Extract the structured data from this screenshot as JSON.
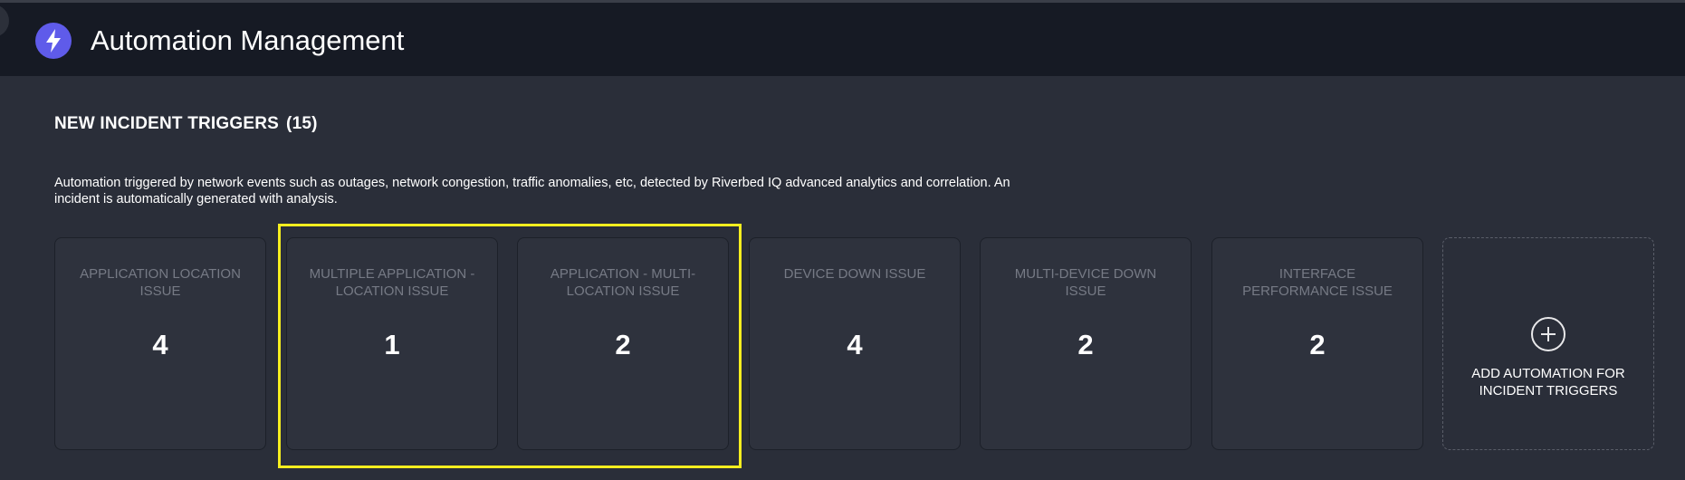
{
  "header": {
    "title": "Automation Management",
    "logo_icon": "lightning-bolt-icon"
  },
  "section": {
    "title": "NEW INCIDENT TRIGGERS",
    "count": "(15)",
    "description": "Automation triggered by network events such as outages, network congestion, traffic anomalies, etc, detected by Riverbed IQ advanced analytics and correlation. An incident is automatically generated with analysis."
  },
  "cards": [
    {
      "label": "APPLICATION LOCATION ISSUE",
      "count": "4"
    },
    {
      "label": "MULTIPLE APPLICATION - LOCATION ISSUE",
      "count": "1"
    },
    {
      "label": "APPLICATION - MULTI-LOCATION ISSUE",
      "count": "2"
    },
    {
      "label": "DEVICE DOWN ISSUE",
      "count": "4"
    },
    {
      "label": "MULTI-DEVICE DOWN ISSUE",
      "count": "2"
    },
    {
      "label": "INTERFACE PERFORMANCE ISSUE",
      "count": "2"
    }
  ],
  "add_card": {
    "label": "ADD AUTOMATION FOR INCIDENT TRIGGERS",
    "icon": "plus-circle-icon"
  },
  "colors": {
    "accent": "#5f5bea",
    "highlight": "#f6ee1f",
    "background": "#2a2e39",
    "header_background": "#161a24"
  }
}
